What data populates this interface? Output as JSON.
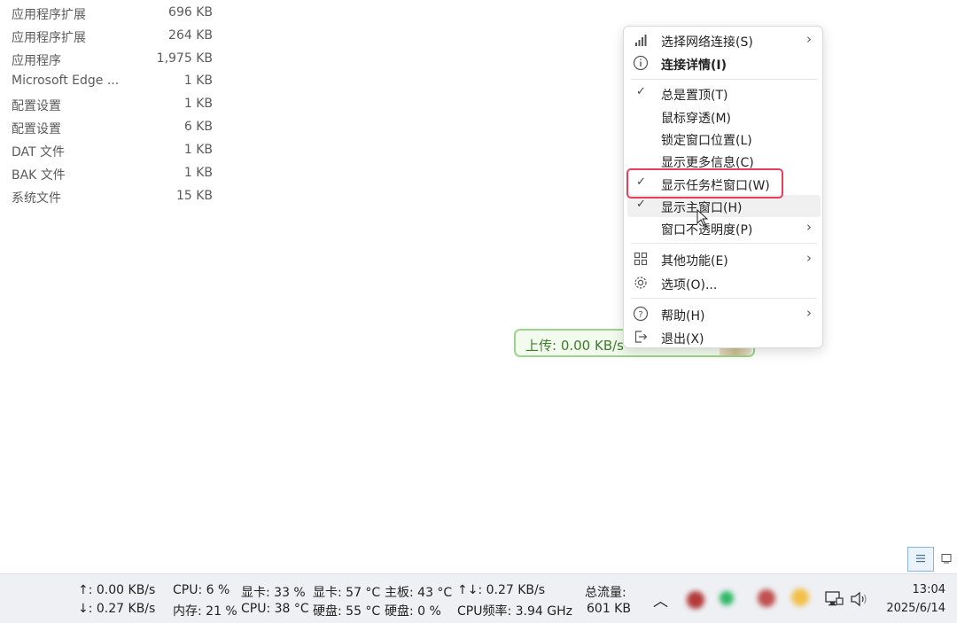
{
  "files": [
    {
      "name": "应用程序扩展",
      "size": "696 KB"
    },
    {
      "name": "应用程序扩展",
      "size": "264 KB"
    },
    {
      "name": "应用程序",
      "size": "1,975 KB"
    },
    {
      "name": "Microsoft Edge ...",
      "size": "1 KB"
    },
    {
      "name": "配置设置",
      "size": "1 KB"
    },
    {
      "name": "配置设置",
      "size": "6 KB"
    },
    {
      "name": "DAT 文件",
      "size": "1 KB"
    },
    {
      "name": "BAK 文件",
      "size": "1 KB"
    },
    {
      "name": "系统文件",
      "size": "15 KB"
    }
  ],
  "floating_window": {
    "text": "上传: 0.00 KB/s"
  },
  "menu": {
    "items": [
      {
        "label": "选择网络连接(S)",
        "icon": "signal-bars-icon",
        "submenu": true
      },
      {
        "label": "连接详情(I)",
        "icon": "info-icon",
        "bold": true
      },
      {
        "label": "总是置顶(T)",
        "checked": true
      },
      {
        "label": "鼠标穿透(M)"
      },
      {
        "label": "锁定窗口位置(L)"
      },
      {
        "label": "显示更多信息(C)"
      },
      {
        "label": "显示任务栏窗口(W)",
        "checked": true,
        "highlighted": true
      },
      {
        "label": "显示主窗口(H)",
        "checked": true,
        "hovered": true
      },
      {
        "label": "窗口不透明度(P)",
        "submenu": true
      },
      {
        "label": "其他功能(E)",
        "icon": "grid-icon",
        "submenu": true
      },
      {
        "label": "选项(O)...",
        "icon": "gear-icon"
      },
      {
        "label": "帮助(H)",
        "icon": "help-icon",
        "submenu": true
      },
      {
        "label": "退出(X)",
        "icon": "exit-icon"
      }
    ]
  },
  "taskbar": {
    "upload": "↑: 0.00 KB/s",
    "download": "↓: 0.27 KB/s",
    "cpu": "CPU: 6 %",
    "gpu_usage": "显卡: 33 %",
    "gpu_temp": "显卡: 57 °C",
    "board_temp": "主板: 43 °C",
    "total_speed": "↑↓: 0.27 KB/s",
    "memory": "内存: 21 %",
    "cpu_temp": "CPU: 38 °C",
    "disk_temp": "硬盘: 55 °C",
    "disk_usage": "硬盘: 0 %",
    "cpu_freq": "CPU频率: 3.94 GHz",
    "total_traffic_label": "总流量:",
    "total_traffic_value": "601 KB",
    "time": "13:04",
    "date": "2025/6/14"
  },
  "icons": {
    "chevron": "chevron-up-icon",
    "check": "check-icon",
    "submenu_arrow": "chevron-right-icon",
    "network": "network-icon",
    "volume": "volume-icon"
  },
  "colors": {
    "highlight_border": "#e8405a",
    "float_border": "#9bd48c",
    "float_text": "#3d7d2c"
  }
}
